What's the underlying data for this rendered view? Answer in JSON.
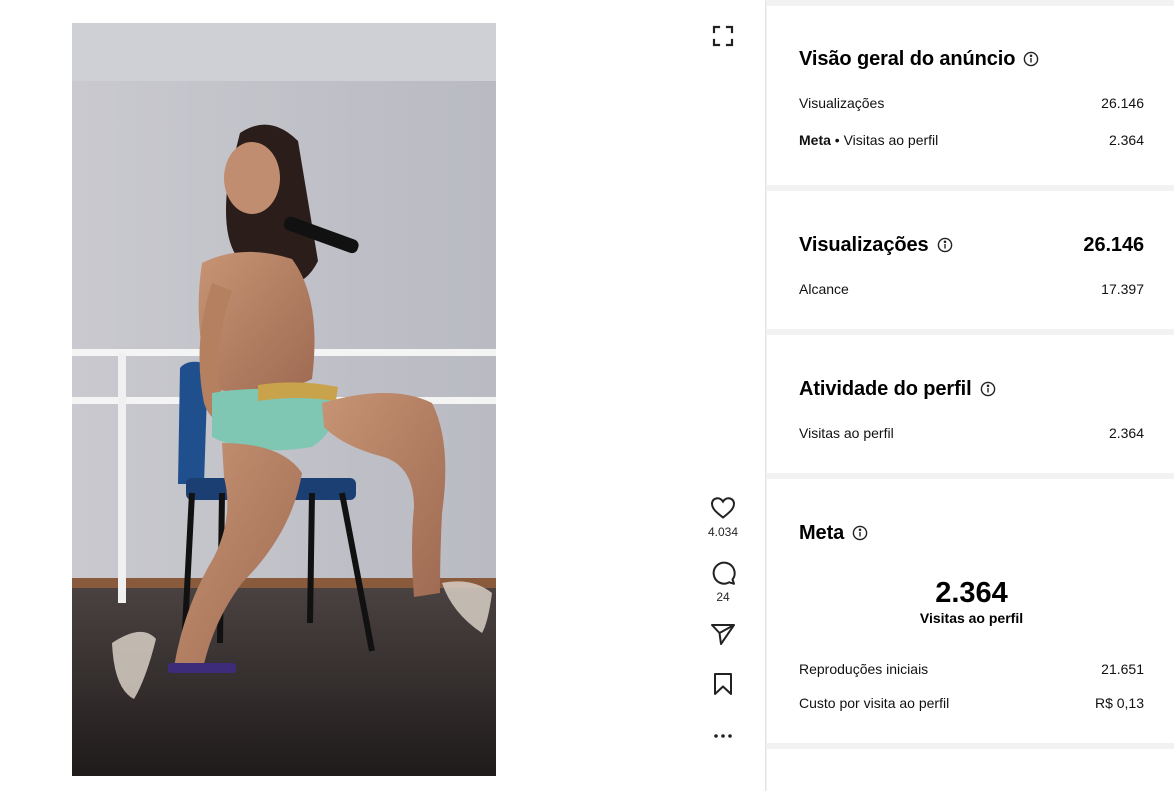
{
  "post": {
    "media_alt": "Vídeo do anúncio",
    "likes": "4.034",
    "comments": "24"
  },
  "icons": {
    "fullscreen": "fullscreen-icon",
    "like": "heart-icon",
    "comment": "comment-bubble-icon",
    "share": "paper-plane-icon",
    "save": "bookmark-icon",
    "more": "more-horizontal-icon",
    "info": "info-circle-icon"
  },
  "overview": {
    "title": "Visão geral do anúncio",
    "rows": [
      {
        "label": "Visualizações",
        "value": "26.146"
      },
      {
        "label_strong": "Meta",
        "label_sep": " • ",
        "label": "Visitas ao perfil",
        "value": "2.364"
      }
    ]
  },
  "views": {
    "title": "Visualizações",
    "total": "26.146",
    "rows": [
      {
        "label": "Alcance",
        "value": "17.397"
      }
    ]
  },
  "profile_activity": {
    "title": "Atividade do perfil",
    "rows": [
      {
        "label": "Visitas ao perfil",
        "value": "2.364"
      }
    ]
  },
  "goal": {
    "title": "Meta",
    "hero_value": "2.364",
    "hero_label": "Visitas ao perfil",
    "rows": [
      {
        "label": "Reproduções iniciais",
        "value": "21.651"
      },
      {
        "label": "Custo por visita ao perfil",
        "value": "R$ 0,13"
      }
    ]
  }
}
